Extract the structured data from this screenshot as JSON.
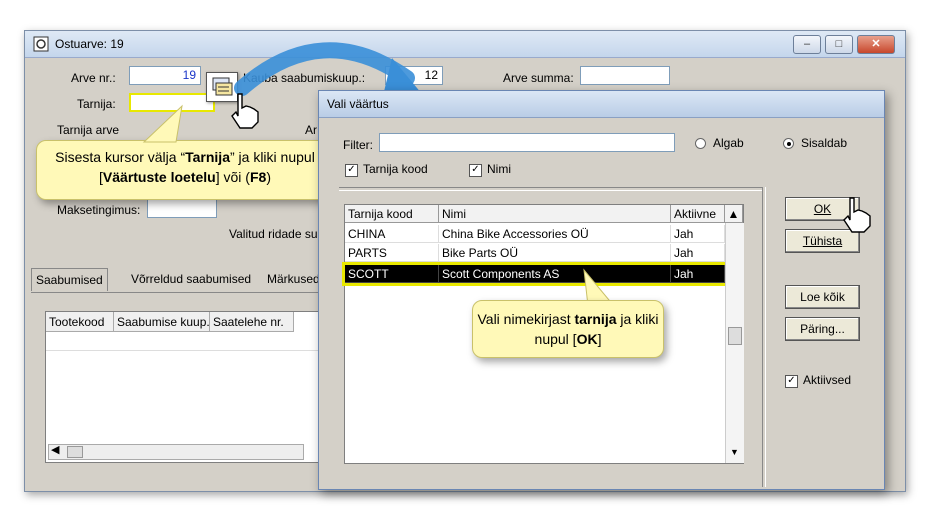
{
  "back_window": {
    "title": "Ostuarve: 19",
    "arve_nr_label": "Arve nr.:",
    "arve_nr_value": "19",
    "kauba_label": "Kauba saabumiskuup.:",
    "date_value": "12",
    "arve_summa_label": "Arve summa:",
    "tarnija_label": "Tarnija:",
    "tarnija_arve_label": "Tarnija arve",
    "ar_label": "Ar",
    "maksetingimus_label": "Maksetingimus:",
    "valitud_label": "Valitud ridade sur",
    "tabs": [
      "Saabumised",
      "Võrreldud saabumised",
      "Märkused"
    ],
    "grid_headers": [
      "Tootekood",
      "Saabumise kuup.",
      "Saatelehe nr."
    ]
  },
  "dialog": {
    "title": "Vali väärtus",
    "filter_label": "Filter:",
    "radio_algab": "Algab",
    "radio_sisaldab": "Sisaldab",
    "chk_tarnija_kood": "Tarnija kood",
    "chk_nimi": "Nimi",
    "columns": [
      "Tarnija kood",
      "Nimi",
      "Aktiivne"
    ],
    "rows": [
      {
        "code": "CHINA",
        "name": "China Bike Accessories OÜ",
        "active": "Jah"
      },
      {
        "code": "PARTS",
        "name": "Bike Parts OÜ",
        "active": "Jah"
      },
      {
        "code": "SCOTT",
        "name": "Scott Components AS",
        "active": "Jah"
      }
    ],
    "ok_label": "OK",
    "cancel_label": "Tühista",
    "load_all_label": "Loe kõik",
    "query_label": "Päring...",
    "active_label": "Aktiivsed"
  },
  "callouts": {
    "left_pre": "Sisesta kursor välja “",
    "left_b1": "Tarnija",
    "left_mid": "” ja kliki nupul [",
    "left_b2": "Väärtuste loetelu",
    "left_post": "] või (",
    "left_b3": "F8",
    "left_end": ")",
    "right_pre": "Vali nimekirjast ",
    "right_b1": "tarnija",
    "right_mid": " ja kliki nupul [",
    "right_b2": "OK",
    "right_end": "]"
  },
  "colors": {
    "highlight": "#e8e800",
    "callout_bg": "#fff9b8",
    "arrow": "#3a8fd8"
  }
}
